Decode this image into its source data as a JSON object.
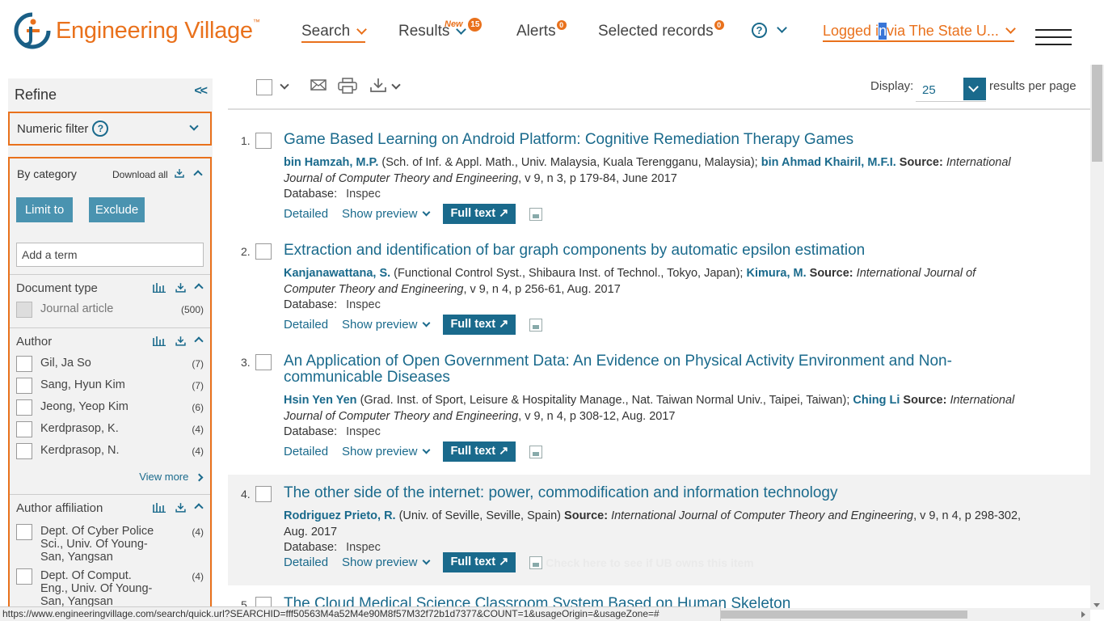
{
  "header": {
    "logo_text": "Engineering Village",
    "logo_tm": "™",
    "nav": {
      "search": "Search",
      "results": "Results",
      "results_new": "New",
      "results_count": "15",
      "alerts": "Alerts",
      "alerts_count": "0",
      "selected": "Selected records",
      "selected_count": "0",
      "help": "?",
      "login_pre": "Logged i",
      "login_hl": "n",
      "login_post": " via The State U..."
    }
  },
  "sidebar": {
    "title": "Refine",
    "collapse": "<<",
    "numeric_filter": "Numeric filter",
    "numeric_help": "?",
    "by_category": "By category",
    "download_all": "Download all",
    "limit_to": "Limit to",
    "exclude": "Exclude",
    "term_placeholder": "Add a term",
    "doc_type": {
      "label": "Document type",
      "items": [
        {
          "label": "Journal article",
          "count": "(500)"
        }
      ]
    },
    "author": {
      "label": "Author",
      "items": [
        {
          "label": "Gil, Ja So",
          "count": "(7)"
        },
        {
          "label": "Sang, Hyun Kim",
          "count": "(7)"
        },
        {
          "label": "Jeong, Yeop Kim",
          "count": "(6)"
        },
        {
          "label": "Kerdprasop, K.",
          "count": "(4)"
        },
        {
          "label": "Kerdprasop, N.",
          "count": "(4)"
        }
      ],
      "view_more": "View more"
    },
    "affiliation": {
      "label": "Author affiliation",
      "items": [
        {
          "label": "Dept. Of Cyber Police Sci., Univ. Of Young-San, Yangsan",
          "count": "(4)"
        },
        {
          "label": "Dept. Of Comput. Eng., Univ. Of Young-San, Yangsan",
          "count": "(4)"
        }
      ]
    }
  },
  "toolbar": {
    "display_label": "Display:",
    "display_value": "25",
    "per_page": "results per page"
  },
  "results": [
    {
      "num": "1.",
      "title": "Game Based Learning on Android Platform: Cognitive Remediation Therapy Games",
      "author1": "bin Hamzah, M.P.",
      "aff1": " (Sch. of Inf. & Appl. Math., Univ. Malaysia, Kuala Terengganu, Malaysia); ",
      "author2": "bin Ahmad Khairil, M.F.I.",
      "source_label": " Source: ",
      "journal": "International Journal of Computer Theory and Engineering",
      "details": ", v 9, n 3, p 179-84, June 2017"
    },
    {
      "num": "2.",
      "title": "Extraction and identification of bar graph components by automatic epsilon estimation",
      "author1": "Kanjanawattana, S.",
      "aff1": " (Functional Control Syst., Shibaura Inst. of Technol., Tokyo, Japan); ",
      "author2": "Kimura, M.",
      "source_label": " Source: ",
      "journal": "International Journal of Computer Theory and Engineering",
      "details": ", v 9, n 4, p 256-61, Aug. 2017"
    },
    {
      "num": "3.",
      "title": "An Application of Open Government Data: An Evidence on Physical Activity Environment and Non-communicable Diseases",
      "author1": "Hsin Yen Yen",
      "aff1": " (Grad. Inst. of Sport, Leisure & Hospitality Manage., Nat. Taiwan Normal Univ., Taipei, Taiwan); ",
      "author2": "Ching Li",
      "source_label": " Source: ",
      "journal": "International Journal of Computer Theory and Engineering",
      "details": ", v 9, n 4, p 308-12, Aug. 2017"
    },
    {
      "num": "4.",
      "title": "The other side of the internet: power, commodification and information technology",
      "author1": "Rodriguez Prieto, R.",
      "aff1": " (Univ. of Seville, Seville, Spain)",
      "author2": "",
      "source_label": " Source: ",
      "journal": "International Journal of Computer Theory and Engineering",
      "details": ", v 9, n 4, p 298-302, Aug. 2017"
    },
    {
      "num": "5.",
      "title": "The Cloud Medical Science Classroom System Based on Human Skeleton"
    }
  ],
  "result_ui": {
    "database_label": "Database:",
    "database_value": "Inspec",
    "detailed": "Detailed",
    "show_preview": "Show preview",
    "full_text": "Full text",
    "full_text_arrow": "↗",
    "ub_link": "Check here to see if UB owns this item"
  },
  "statusbar": {
    "url": "https://www.engineeringvillage.com/search/quick.url?SEARCHID=fff50563M4a52M4e90M8f57M32f72b1d7377&COUNT=1&usageOrigin=&usageZone=#"
  },
  "colors": {
    "brand_orange": "#e9711c",
    "link_teal": "#1a6a8c",
    "button_teal": "#4a93b0"
  }
}
